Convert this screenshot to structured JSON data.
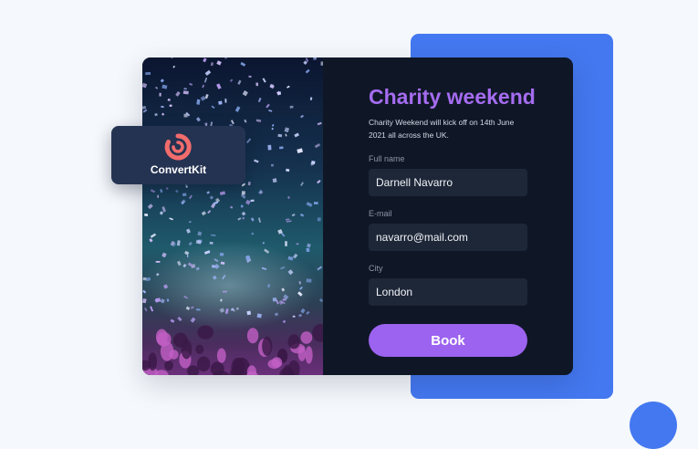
{
  "form": {
    "title": "Charity weekend",
    "description": "Charity Weekend will kick off on 14th June 2021 all across the UK.",
    "fields": [
      {
        "label": "Full name",
        "value": "Darnell Navarro"
      },
      {
        "label": "E-mail",
        "value": "navarro@mail.com"
      },
      {
        "label": "City",
        "value": "London"
      }
    ],
    "submit_label": "Book"
  },
  "brand": {
    "name": "ConvertKit",
    "icon": "convertkit-logo-icon",
    "color": "#f26c6c"
  },
  "colors": {
    "accent": "#9b63ef",
    "title": "#a56cf0",
    "panel": "#4478f0",
    "card": "#0f1727",
    "input": "#1e2738"
  }
}
